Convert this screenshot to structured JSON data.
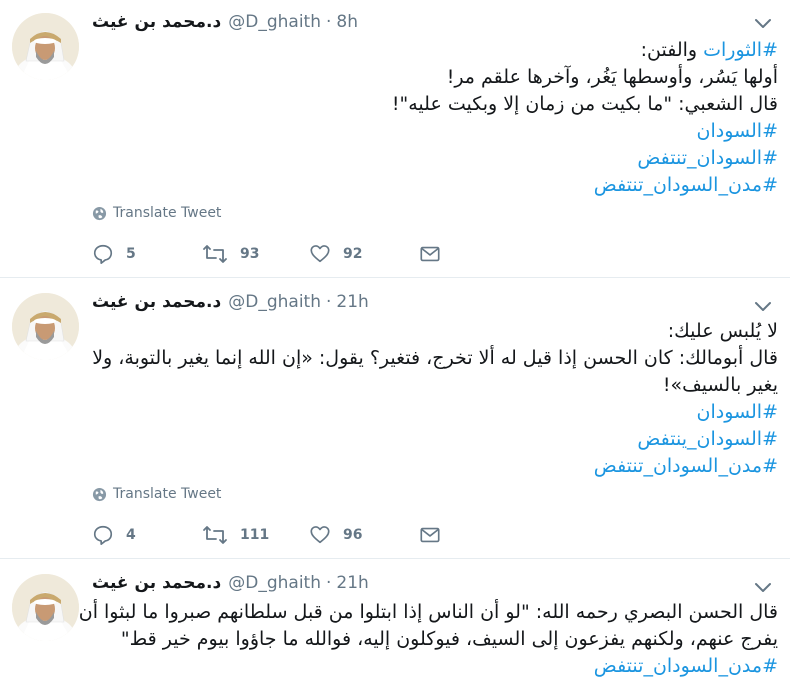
{
  "tweets": [
    {
      "name": "د.محمد بن غيث",
      "handle": "@D_ghaith",
      "separator": "·",
      "time": "8h",
      "lines": [
        [
          {
            "text": "#الثورات",
            "tag": true
          },
          {
            "text": " والفتن:",
            "tag": false
          }
        ],
        [
          {
            "text": "أولها يَسُر، وأوسطها يَغُر، وآخرها علقم مر!",
            "tag": false
          }
        ],
        [
          {
            "text": "قال الشعبي: \"ما بكيت من زمان إلا وبكيت عليه\"!",
            "tag": false
          }
        ],
        [
          {
            "text": "#السودان",
            "tag": true
          }
        ],
        [
          {
            "text": "#السودان_تنتفض",
            "tag": true
          }
        ],
        [
          {
            "text": "#مدن_السودان_تنتفض",
            "tag": true
          }
        ]
      ],
      "translate_label": "Translate Tweet",
      "replies": "5",
      "retweets": "93",
      "likes": "92"
    },
    {
      "name": "د.محمد بن غيث",
      "handle": "@D_ghaith",
      "separator": "·",
      "time": "21h",
      "lines": [
        [
          {
            "text": "لا يُلبس عليك:",
            "tag": false
          }
        ],
        [
          {
            "text": "قال أبومالك: كان الحسن إذا قيل له ألا تخرج، فتغير؟ يقول: «إن الله إنما يغير بالتوبة، ولا",
            "tag": false
          }
        ],
        [
          {
            "text": "يغير بالسيف»!",
            "tag": false
          }
        ],
        [
          {
            "text": "#السودان",
            "tag": true
          }
        ],
        [
          {
            "text": "#السودان_ينتفض",
            "tag": true
          }
        ],
        [
          {
            "text": "#مدن_السودان_تنتفض",
            "tag": true
          }
        ]
      ],
      "translate_label": "Translate Tweet",
      "replies": "4",
      "retweets": "111",
      "likes": "96"
    },
    {
      "name": "د.محمد بن غيث",
      "handle": "@D_ghaith",
      "separator": "·",
      "time": "21h",
      "lines": [
        [
          {
            "text": "قال الحسن البصري رحمه الله: \"لو أن الناس إذا ابتلوا من قبل سلطانهم صبروا ما لبثوا أن",
            "tag": false
          }
        ],
        [
          {
            "text": "يفرج عنهم، ولكنهم يفزعون إلى السيف، فيوكلون إليه، فوالله ما جاؤوا بيوم خير قط\"",
            "tag": false
          }
        ],
        [
          {
            "text": "#مدن_السودان_تنتفض",
            "tag": true
          }
        ]
      ],
      "translate_label": "",
      "replies": "",
      "retweets": "",
      "likes": ""
    }
  ],
  "colors": {
    "hashtag": "#1b95e0",
    "secondary": "#657786",
    "divider": "#e6ecf0"
  }
}
